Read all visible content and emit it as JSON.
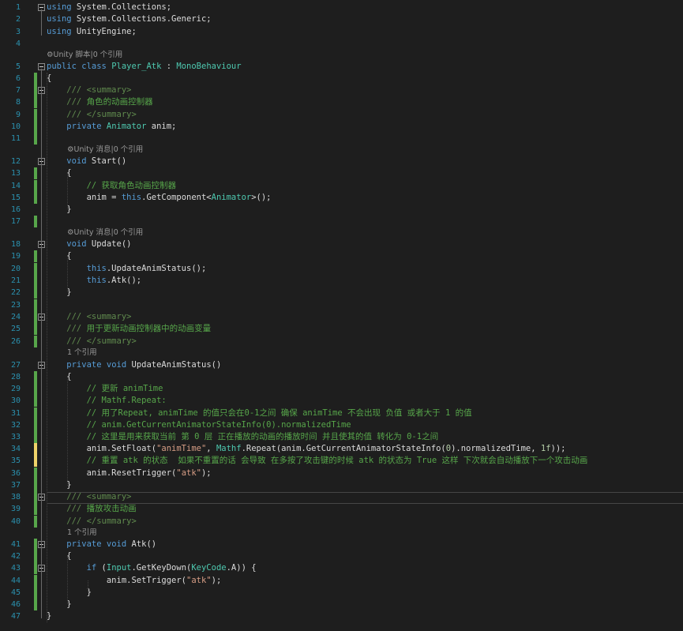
{
  "editor": {
    "lines": [
      {
        "n": "1",
        "t": [
          [
            "kw",
            "using"
          ],
          [
            "txt",
            " System.Collections;"
          ]
        ]
      },
      {
        "n": "2",
        "t": [
          [
            "kw",
            "using"
          ],
          [
            "txt",
            " System.Collections.Generic;"
          ]
        ]
      },
      {
        "n": "3",
        "t": [
          [
            "kw",
            "using"
          ],
          [
            "txt",
            " UnityEngine;"
          ]
        ]
      },
      {
        "n": "4",
        "t": []
      },
      {
        "n": "5",
        "t": [
          [
            "kw",
            "public"
          ],
          [
            "txt",
            " "
          ],
          [
            "kw",
            "class"
          ],
          [
            "txt",
            " "
          ],
          [
            "ty",
            "Player_Atk"
          ],
          [
            "txt",
            " : "
          ],
          [
            "ty",
            "MonoBehaviour"
          ]
        ]
      },
      {
        "n": "6",
        "t": [
          [
            "txt",
            "{"
          ]
        ]
      },
      {
        "n": "7",
        "t": [
          [
            "xd",
            "    /// <summary>"
          ]
        ]
      },
      {
        "n": "8",
        "t": [
          [
            "xd",
            "    /// "
          ],
          [
            "cm",
            "角色的动画控制器"
          ]
        ]
      },
      {
        "n": "9",
        "t": [
          [
            "xd",
            "    /// </summary>"
          ]
        ]
      },
      {
        "n": "10",
        "t": [
          [
            "kw",
            "    private"
          ],
          [
            "txt",
            " "
          ],
          [
            "ty",
            "Animator"
          ],
          [
            "txt",
            " anim;"
          ]
        ]
      },
      {
        "n": "11",
        "t": []
      },
      {
        "n": "12",
        "t": [
          [
            "kw",
            "    void"
          ],
          [
            "txt",
            " Start()"
          ]
        ]
      },
      {
        "n": "13",
        "t": [
          [
            "txt",
            "    {"
          ]
        ]
      },
      {
        "n": "14",
        "t": [
          [
            "cm",
            "        // 获取角色动画控制器"
          ]
        ]
      },
      {
        "n": "15",
        "t": [
          [
            "txt",
            "        anim = "
          ],
          [
            "kw",
            "this"
          ],
          [
            "txt",
            ".GetComponent<"
          ],
          [
            "ty",
            "Animator"
          ],
          [
            "txt",
            ">();"
          ]
        ]
      },
      {
        "n": "16",
        "t": [
          [
            "txt",
            "    }"
          ]
        ]
      },
      {
        "n": "17",
        "t": []
      },
      {
        "n": "18",
        "t": [
          [
            "kw",
            "    void"
          ],
          [
            "txt",
            " Update()"
          ]
        ]
      },
      {
        "n": "19",
        "t": [
          [
            "txt",
            "    {"
          ]
        ]
      },
      {
        "n": "20",
        "t": [
          [
            "kw",
            "        this"
          ],
          [
            "txt",
            ".UpdateAnimStatus();"
          ]
        ]
      },
      {
        "n": "21",
        "t": [
          [
            "kw",
            "        this"
          ],
          [
            "txt",
            ".Atk();"
          ]
        ]
      },
      {
        "n": "22",
        "t": [
          [
            "txt",
            "    }"
          ]
        ]
      },
      {
        "n": "23",
        "t": []
      },
      {
        "n": "24",
        "t": [
          [
            "xd",
            "    /// <summary>"
          ]
        ]
      },
      {
        "n": "25",
        "t": [
          [
            "xd",
            "    /// "
          ],
          [
            "cm",
            "用于更新动画控制器中的动画变量"
          ]
        ]
      },
      {
        "n": "26",
        "t": [
          [
            "xd",
            "    /// </summary>"
          ]
        ]
      },
      {
        "n": "27",
        "t": [
          [
            "kw",
            "    private"
          ],
          [
            "txt",
            " "
          ],
          [
            "kw",
            "void"
          ],
          [
            "txt",
            " UpdateAnimStatus()"
          ]
        ]
      },
      {
        "n": "28",
        "t": [
          [
            "txt",
            "    {"
          ]
        ]
      },
      {
        "n": "29",
        "t": [
          [
            "cm",
            "        // 更新 animTime"
          ]
        ]
      },
      {
        "n": "30",
        "t": [
          [
            "cm",
            "        // Mathf.Repeat:"
          ]
        ]
      },
      {
        "n": "31",
        "t": [
          [
            "cm",
            "        // 用了Repeat, animTime 的值只会在0-1之间 确保 animTime 不会出现 负值 或者大于 1 的值"
          ]
        ]
      },
      {
        "n": "32",
        "t": [
          [
            "cm",
            "        // anim.GetCurrentAnimatorStateInfo(0).normalizedTime"
          ]
        ]
      },
      {
        "n": "33",
        "t": [
          [
            "cm",
            "        // 这里是用来获取当前 第 0 层 正在播放的动画的播放时间 并且使其的值 转化为 0-1之间"
          ]
        ]
      },
      {
        "n": "34",
        "t": [
          [
            "txt",
            "        anim.SetFloat("
          ],
          [
            "st",
            "\"animTime\""
          ],
          [
            "txt",
            ", "
          ],
          [
            "ty",
            "Mathf"
          ],
          [
            "txt",
            ".Repeat(anim.GetCurrentAnimatorStateInfo("
          ],
          [
            "nm",
            "0"
          ],
          [
            "txt",
            ").normalizedTime, "
          ],
          [
            "nm",
            "1f"
          ],
          [
            "txt",
            "));"
          ]
        ]
      },
      {
        "n": "35",
        "t": [
          [
            "cm",
            "        // 重置 atk 的状态  如果不重置的话 会导致 在多按了攻击键的时候 atk 的状态为 True 这样 下次就会自动播放下一个攻击动画"
          ]
        ]
      },
      {
        "n": "36",
        "t": [
          [
            "txt",
            "        anim.ResetTrigger("
          ],
          [
            "st",
            "\"atk\""
          ],
          [
            "txt",
            ");"
          ]
        ]
      },
      {
        "n": "37",
        "t": [
          [
            "txt",
            "    }"
          ]
        ]
      },
      {
        "n": "38",
        "t": [
          [
            "xd",
            "    /// <summary>"
          ]
        ]
      },
      {
        "n": "39",
        "t": [
          [
            "xd",
            "    /// "
          ],
          [
            "cm",
            "播放攻击动画"
          ]
        ]
      },
      {
        "n": "40",
        "t": [
          [
            "xd",
            "    /// </summary>"
          ]
        ]
      },
      {
        "n": "41",
        "t": [
          [
            "kw",
            "    private"
          ],
          [
            "txt",
            " "
          ],
          [
            "kw",
            "void"
          ],
          [
            "txt",
            " Atk()"
          ]
        ]
      },
      {
        "n": "42",
        "t": [
          [
            "txt",
            "    {"
          ]
        ]
      },
      {
        "n": "43",
        "t": [
          [
            "kw",
            "        if"
          ],
          [
            "txt",
            " ("
          ],
          [
            "ty",
            "Input"
          ],
          [
            "txt",
            ".GetKeyDown("
          ],
          [
            "ty",
            "KeyCode"
          ],
          [
            "txt",
            ".A)) {"
          ]
        ]
      },
      {
        "n": "44",
        "t": [
          [
            "txt",
            "            anim.SetTrigger("
          ],
          [
            "st",
            "\"atk\""
          ],
          [
            "txt",
            ");"
          ]
        ]
      },
      {
        "n": "45",
        "t": [
          [
            "txt",
            "        }"
          ]
        ]
      },
      {
        "n": "46",
        "t": [
          [
            "txt",
            "    }"
          ]
        ]
      },
      {
        "n": "47",
        "t": [
          [
            "txt",
            "}"
          ]
        ]
      }
    ],
    "lens": {
      "class_refs": "⚙Unity 脚本|0 个引用",
      "start_refs": "⚙Unity 消息|0 个引用",
      "update_refs": "⚙Unity 消息|0 个引用",
      "updateanim_refs": "1 个引用",
      "atk_refs": "1 个引用"
    }
  },
  "colors": {
    "background": "#1e1e1e",
    "keyword": "#569cd6",
    "type": "#4ec9b0",
    "comment": "#57a64a",
    "string": "#d69d85",
    "number": "#b5cea8",
    "line_number": "#2b91af",
    "change_saved": "#57a64a",
    "change_unsaved": "#efd36a"
  }
}
